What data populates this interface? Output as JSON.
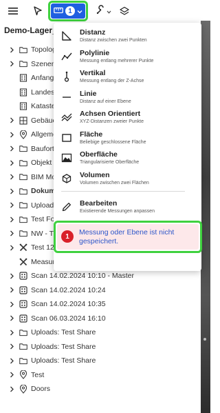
{
  "toolbar": {
    "menu_icon": "hamburger-icon",
    "cursor_icon": "pointer-icon",
    "measure_icon": "ruler-icon",
    "measure_badge": "1",
    "tools_icon": "wrench-icon",
    "layers_icon": "layers-icon"
  },
  "project": {
    "title": "Demo-Lager_u"
  },
  "tree": [
    {
      "label": "Topolog",
      "icon": "folder-icon",
      "chevron": true,
      "bold": false
    },
    {
      "label": "Szenen",
      "icon": "folder-icon",
      "chevron": true,
      "bold": false
    },
    {
      "label": "Anfang",
      "icon": "building-icon",
      "chevron": false,
      "bold": false
    },
    {
      "label": "Landest",
      "icon": "building-icon",
      "chevron": false,
      "bold": false
    },
    {
      "label": "Kataste",
      "icon": "building-icon",
      "chevron": false,
      "bold": false
    },
    {
      "label": "Gebäuc",
      "icon": "grid-layers-icon",
      "chevron": true,
      "bold": false
    },
    {
      "label": "Allgeme",
      "icon": "location-pin-icon",
      "chevron": true,
      "bold": false
    },
    {
      "label": "Baufort",
      "icon": "folder-icon",
      "chevron": true,
      "bold": false
    },
    {
      "label": "Objekt",
      "icon": "folder-icon",
      "chevron": true,
      "bold": false
    },
    {
      "label": "BIM Mo",
      "icon": "folder-icon",
      "chevron": true,
      "bold": false
    },
    {
      "label": "Dokum",
      "icon": "folder-icon",
      "chevron": true,
      "bold": true
    },
    {
      "label": "Uploads",
      "icon": "folder-icon",
      "chevron": true,
      "bold": false
    },
    {
      "label": "Test Fo",
      "icon": "folder-icon",
      "chevron": true,
      "bold": false
    },
    {
      "label": "NW - T",
      "icon": "folder-icon",
      "chevron": true,
      "bold": false
    },
    {
      "label": "Test 12",
      "icon": "measure-cross-icon",
      "chevron": true,
      "bold": false
    },
    {
      "label": "Measurement Test",
      "icon": "measure-cross-icon",
      "chevron": false,
      "bold": false
    },
    {
      "label": "Scan 14.02.2024 10:10 - Master",
      "icon": "scan-icon",
      "chevron": true,
      "bold": false
    },
    {
      "label": "Scan 14.02.2024 10:24",
      "icon": "scan-icon",
      "chevron": true,
      "bold": false
    },
    {
      "label": "Scan 14.02.2024 10:35",
      "icon": "scan-icon",
      "chevron": true,
      "bold": false
    },
    {
      "label": "Scan 06.03.2024 16:10",
      "icon": "scan-icon",
      "chevron": true,
      "bold": false
    },
    {
      "label": "Uploads: Test Share",
      "icon": "folder-icon",
      "chevron": true,
      "bold": false
    },
    {
      "label": "Uploads: Test Share",
      "icon": "folder-icon",
      "chevron": true,
      "bold": false
    },
    {
      "label": "Uploads: Test Share",
      "icon": "folder-icon",
      "chevron": true,
      "bold": false
    },
    {
      "label": "Test",
      "icon": "location-pin-icon",
      "chevron": true,
      "bold": false
    },
    {
      "label": "Doors",
      "icon": "location-pin-icon",
      "chevron": true,
      "bold": false
    }
  ],
  "menu": {
    "items": [
      {
        "key": "distanz",
        "title": "Distanz",
        "desc": "Distanz zwischen zwei Punkten",
        "icon": "angle-icon"
      },
      {
        "key": "polylinie",
        "title": "Polylinie",
        "desc": "Messung entlang mehrerer Punkte",
        "icon": "polyline-icon"
      },
      {
        "key": "vertikal",
        "title": "Vertikal",
        "desc": "Messung entlang der Z-Achse",
        "icon": "vertical-icon"
      },
      {
        "key": "linie",
        "title": "Linie",
        "desc": "Distanz auf einer Ebene",
        "icon": "line-icon"
      },
      {
        "key": "achsen",
        "title": "Achsen Orientiert",
        "desc": "XYZ-Distanzen zweier Punkte",
        "icon": "axes-icon"
      },
      {
        "key": "flaeche",
        "title": "Fläche",
        "desc": "Beliebige geschlossene Fläche",
        "icon": "area-icon"
      },
      {
        "key": "oberflaeche",
        "title": "Oberfläche",
        "desc": "Triangularisierte Oberfläche",
        "icon": "surface-icon"
      },
      {
        "key": "volumen",
        "title": "Volumen",
        "desc": "Volumen zwischen zwei Flächen",
        "icon": "volume-icon"
      }
    ],
    "edit": {
      "title": "Bearbeiten",
      "desc": "Existierende Messungen anpassen",
      "icon": "pencil-icon"
    }
  },
  "error": {
    "number": "1",
    "message": "Messung oder Ebene ist nicht gespeichert.",
    "color": "#d9212a"
  },
  "colors": {
    "accent": "#1f5fe0",
    "highlight": "#3fd13f",
    "error_bg": "#fde8ea",
    "error_text": "#2c56c9"
  }
}
